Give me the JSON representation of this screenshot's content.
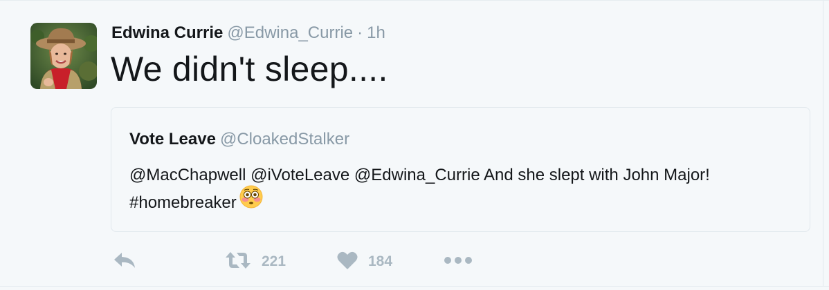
{
  "tweet": {
    "author": {
      "name": "Edwina Currie",
      "handle": "@Edwina_Currie",
      "separator": "·",
      "timestamp": "1h",
      "avatar_icon": "profile-photo"
    },
    "text": "We didn't sleep....",
    "quoted": {
      "name": "Vote Leave",
      "handle": "@CloakedStalker",
      "text": "@MacChapwell @iVoteLeave @Edwina_Currie And she slept with John Major! #homebreaker",
      "emoji": "flushed-face"
    },
    "actions": {
      "reply_icon": "reply-icon",
      "retweet_icon": "retweet-icon",
      "retweet_count": "221",
      "like_icon": "heart-icon",
      "like_count": "184",
      "more_icon": "more-icon"
    }
  },
  "colors": {
    "background": "#f5f8fa",
    "text": "#14171a",
    "secondary": "#8899a6",
    "action": "#aab8c2",
    "border": "#e1e8ed"
  }
}
